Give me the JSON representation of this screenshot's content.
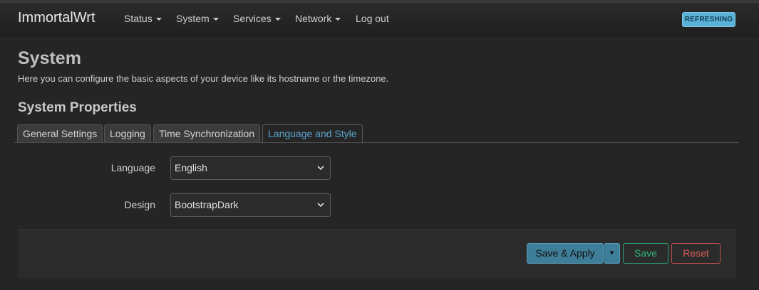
{
  "navbar": {
    "brand": "ImmortalWrt",
    "menu": [
      {
        "label": "Status",
        "caret": true
      },
      {
        "label": "System",
        "caret": true
      },
      {
        "label": "Services",
        "caret": true
      },
      {
        "label": "Network",
        "caret": true
      },
      {
        "label": "Log out",
        "caret": false
      }
    ],
    "status_badge": "REFRESHING"
  },
  "page": {
    "title": "System",
    "description": "Here you can configure the basic aspects of your device like its hostname or the timezone."
  },
  "section": {
    "title": "System Properties",
    "tabs": [
      {
        "label": "General Settings",
        "active": false
      },
      {
        "label": "Logging",
        "active": false
      },
      {
        "label": "Time Synchronization",
        "active": false
      },
      {
        "label": "Language and Style",
        "active": true
      }
    ]
  },
  "form": {
    "language": {
      "label": "Language",
      "value": "English"
    },
    "design": {
      "label": "Design",
      "value": "BootstrapDark"
    }
  },
  "actions": {
    "save_apply": "Save & Apply",
    "dropdown_glyph": "▾",
    "save": "Save",
    "reset": "Reset"
  },
  "colors": {
    "accent": "#5aa5cc",
    "badge": "#5ab2d8",
    "apply": "#3f7e98",
    "save": "#2fb37c",
    "reset": "#d45c58"
  },
  "icons": {
    "menu_caret": "caret-down-icon",
    "select_chevron": "chevron-down-icon"
  }
}
